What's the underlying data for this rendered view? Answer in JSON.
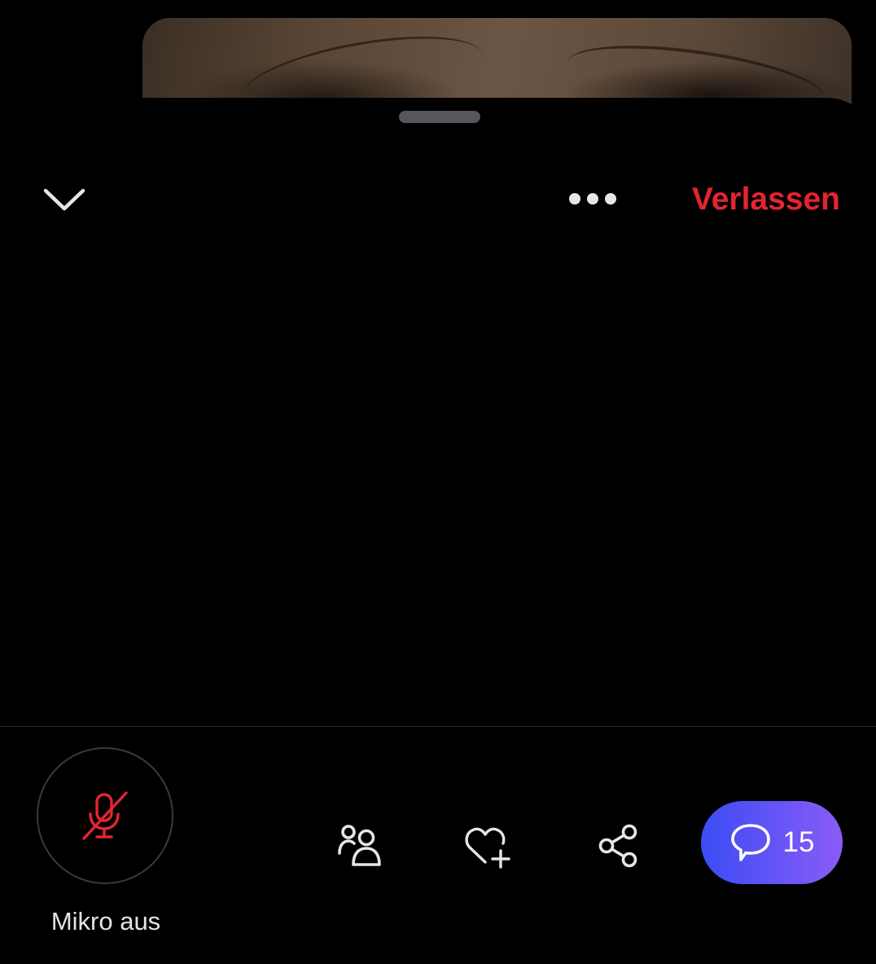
{
  "header": {
    "leave_label": "Verlassen"
  },
  "mic": {
    "label": "Mikro aus"
  },
  "chat": {
    "count": "15"
  },
  "icons": {
    "collapse": "chevron-down-icon",
    "more": "more-horizontal-icon",
    "mic": "mic-off-icon",
    "participants": "people-icon",
    "favorite": "heart-add-icon",
    "share": "share-icon",
    "chat": "chat-bubble-icon"
  },
  "colors": {
    "accent_red": "#e5242f",
    "chat_gradient_start": "#3b4cf5",
    "chat_gradient_end": "#8a5cf6",
    "icon_light": "#e6e6e6"
  }
}
